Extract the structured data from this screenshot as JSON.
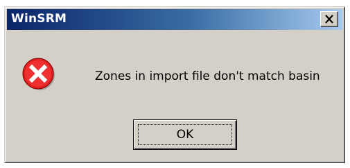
{
  "window": {
    "title": "WinSRM",
    "close_glyph": "✕"
  },
  "dialog": {
    "icon": "error-icon",
    "message": "Zones in import file don't match basin",
    "ok_label": "OK"
  },
  "colors": {
    "titlebar_start": "#0a246a",
    "titlebar_end": "#a6caf0",
    "dialog_bg": "#d4d0c8",
    "error_red": "#e02020"
  }
}
